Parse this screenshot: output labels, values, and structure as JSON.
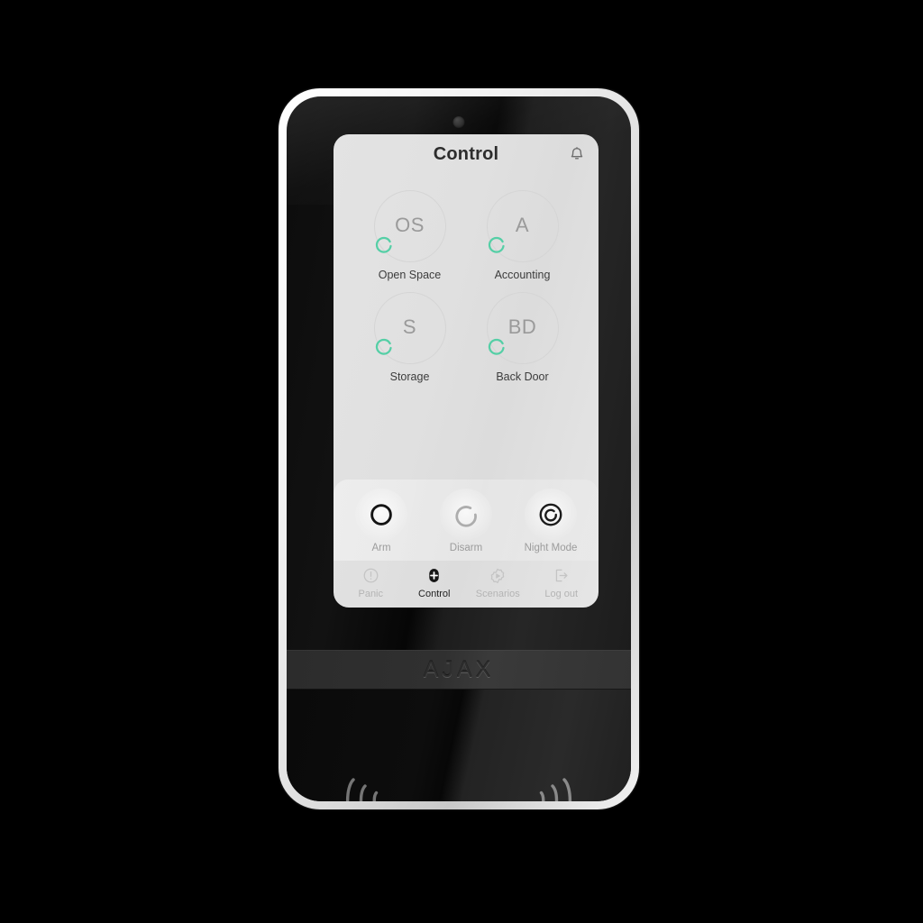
{
  "device": {
    "brand_logo": "AJAX",
    "sensor": "proximity-sensor",
    "readers": [
      {
        "name": "nfc-reader-left",
        "icon": "nfc-waves-left-icon"
      },
      {
        "name": "nfc-reader-right",
        "icon": "nfc-waves-right-icon"
      }
    ]
  },
  "header": {
    "title": "Control",
    "bell_icon": "bell-icon"
  },
  "groups": [
    {
      "abbr": "OS",
      "label": "Open Space",
      "status": "armed-arc"
    },
    {
      "abbr": "A",
      "label": "Accounting",
      "status": "armed-arc"
    },
    {
      "abbr": "S",
      "label": "Storage",
      "status": "armed-arc"
    },
    {
      "abbr": "BD",
      "label": "Back Door",
      "status": "armed-arc"
    }
  ],
  "actions": [
    {
      "label": "Arm",
      "icon": "arm-circle-icon",
      "state": "selected"
    },
    {
      "label": "Disarm",
      "icon": "disarm-arc-icon",
      "state": "normal"
    },
    {
      "label": "Night Mode",
      "icon": "night-mode-icon",
      "state": "normal"
    }
  ],
  "nav": [
    {
      "label": "Panic",
      "icon": "panic-exclamation-icon",
      "active": false
    },
    {
      "label": "Control",
      "icon": "control-plus-icon",
      "active": true
    },
    {
      "label": "Scenarios",
      "icon": "gear-play-icon",
      "active": false
    },
    {
      "label": "Log out",
      "icon": "logout-arrow-icon",
      "active": false
    }
  ],
  "colors": {
    "accent_green": "#55cfa6",
    "screen_bg": "#e0e0e0",
    "text_primary": "#2d2d2d",
    "text_muted": "#9c9c9c",
    "device_black": "#121212",
    "device_rim": "#f0f0f0"
  }
}
